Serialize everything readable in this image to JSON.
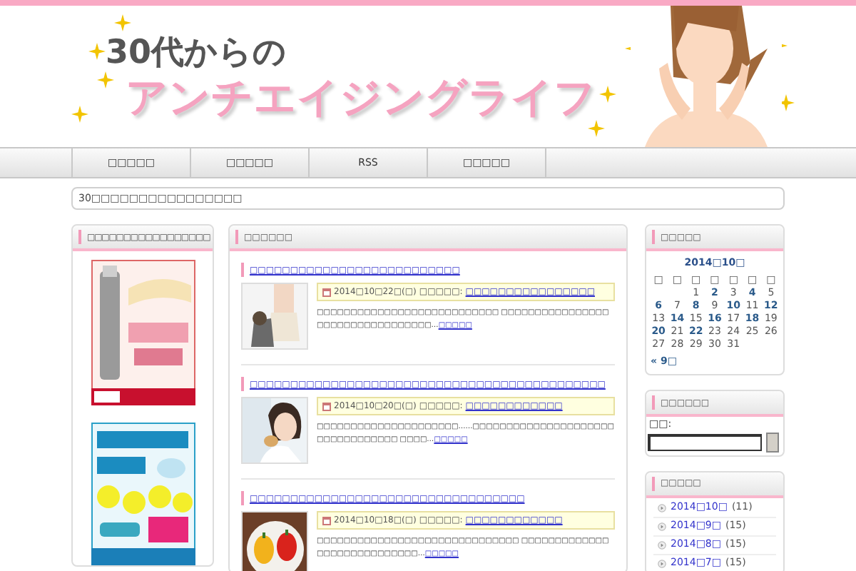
{
  "header": {
    "title_line1": "30代からの",
    "title_line2": "アンチエイジングライフ"
  },
  "nav": [
    {
      "label": "□□□□□"
    },
    {
      "label": "□□□□□"
    },
    {
      "label": "RSS"
    },
    {
      "label": "□□□□□"
    }
  ],
  "description": "30□□□□□□□□□□□□□□□□",
  "left_widget": {
    "title": "□□□□□□□□□□□□□□□□□"
  },
  "main": {
    "title": "□□□□□□",
    "posts": [
      {
        "title": "□□□□□□□□□□□□□□□□□□□□□□□□□□",
        "date": "2014□10□22□(□)",
        "meta_label": "□□□□□:",
        "category": "□□□□□□□□□□□□□□□□",
        "excerpt": "□□□□□□□□□□□□□□□□□□□□□□□□□□□ □□□□□□□□□□□□□□□□□□□□□□□□□□□□□□□□□…",
        "more": "□□□□□"
      },
      {
        "title": "□□□□□□□□□□□□□□□□□□□□□□□□□□□□□□□□□□□□□□□□□□□□",
        "date": "2014□10□20□(□)",
        "meta_label": "□□□□□:",
        "category": "□□□□□□□□□□□□",
        "excerpt": "□□□□□□□□□□□□□□□□□□□□□……□□□□□□□□□□□□□□□□□□□□□□□□□□□□□□□□□ □□□□…",
        "more": "□□□□□"
      },
      {
        "title": "□□□□□□□□□□□□□□□□□□□□□□□□□□□□□□□□□□",
        "date": "2014□10□18□(□)",
        "meta_label": "□□□□□:",
        "category": "□□□□□□□□□□□□",
        "excerpt": "□□□□□□□□□□□□□□□□□□□□□□□□□□□□□□ □□□□□□□□□□□□□□□□□□□□□□□□□□□□…",
        "more": "□□□□□"
      }
    ]
  },
  "calendar": {
    "title": "□□□□□",
    "month": "2014□10□",
    "weekdays": [
      "□",
      "□",
      "□",
      "□",
      "□",
      "□",
      "□"
    ],
    "weeks": [
      [
        {
          "blank": true
        },
        {
          "blank": true
        },
        {
          "day": "1",
          "linked": false
        },
        {
          "day": "2",
          "linked": true
        },
        {
          "day": "3",
          "linked": false
        },
        {
          "day": "4",
          "linked": true
        },
        {
          "day": "5",
          "linked": false
        }
      ],
      [
        {
          "day": "6",
          "linked": true
        },
        {
          "day": "7",
          "linked": false
        },
        {
          "day": "8",
          "linked": true
        },
        {
          "day": "9",
          "linked": false
        },
        {
          "day": "10",
          "linked": true
        },
        {
          "day": "11",
          "linked": false
        },
        {
          "day": "12",
          "linked": true
        }
      ],
      [
        {
          "day": "13",
          "linked": false
        },
        {
          "day": "14",
          "linked": true
        },
        {
          "day": "15",
          "linked": false
        },
        {
          "day": "16",
          "linked": true
        },
        {
          "day": "17",
          "linked": false
        },
        {
          "day": "18",
          "linked": true
        },
        {
          "day": "19",
          "linked": false
        }
      ],
      [
        {
          "day": "20",
          "linked": true
        },
        {
          "day": "21",
          "linked": false
        },
        {
          "day": "22",
          "linked": true
        },
        {
          "day": "23",
          "linked": false
        },
        {
          "day": "24",
          "linked": false
        },
        {
          "day": "25",
          "linked": false
        },
        {
          "day": "26",
          "linked": false
        }
      ],
      [
        {
          "day": "27",
          "linked": false
        },
        {
          "day": "28",
          "linked": false
        },
        {
          "day": "29",
          "linked": false
        },
        {
          "day": "30",
          "linked": false
        },
        {
          "day": "31",
          "linked": false
        }
      ]
    ],
    "prev": "« 9□"
  },
  "search": {
    "title": "□□□□□□",
    "label": "□□:"
  },
  "archives": {
    "title": "□□□□□",
    "items": [
      {
        "label": "2014□10□",
        "count": "(11)"
      },
      {
        "label": "2014□9□",
        "count": "(15)"
      },
      {
        "label": "2014□8□",
        "count": "(15)"
      },
      {
        "label": "2014□7□",
        "count": "(15)"
      }
    ]
  }
}
